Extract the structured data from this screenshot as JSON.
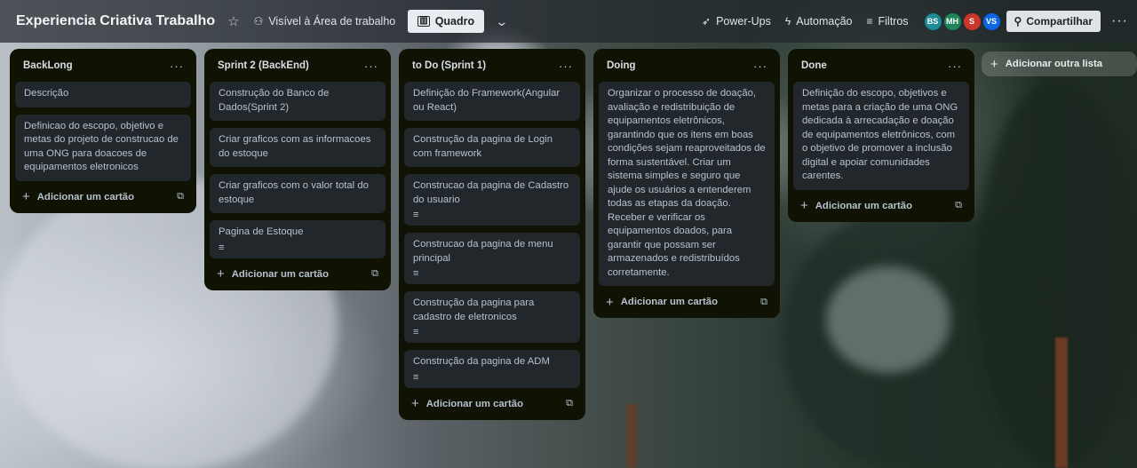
{
  "header": {
    "board_title": "Experiencia Criativa Trabalho",
    "visibility_label": "Visível à Área de trabalho",
    "view_label": "Quadro",
    "powerups_label": "Power-Ups",
    "automation_label": "Automação",
    "filters_label": "Filtros",
    "share_label": "Compartilhar",
    "members": [
      {
        "initials": "BS",
        "color": "#1d8a94"
      },
      {
        "initials": "MH",
        "color": "#1f845a"
      },
      {
        "initials": "S",
        "color": "#c9372c"
      },
      {
        "initials": "VS",
        "color": "#0c66e4"
      }
    ]
  },
  "lists": [
    {
      "title": "BackLong",
      "cards": [
        {
          "text": "Descrição"
        },
        {
          "text": "Definicao do escopo, objetivo e metas do projeto de construcao de uma ONG para doacoes de equipamentos eletronicos"
        }
      ],
      "add_label": "Adicionar um cartão"
    },
    {
      "title": "Sprint 2 (BackEnd)",
      "cards": [
        {
          "text": "Construção do Banco de Dados(Sprint 2)"
        },
        {
          "text": "Criar graficos com as informacoes do estoque"
        },
        {
          "text": "Criar graficos com o valor total do estoque"
        },
        {
          "text": "Pagina de Estoque"
        }
      ],
      "add_label": "Adicionar um cartão"
    },
    {
      "title": "to Do (Sprint 1)",
      "cards": [
        {
          "text": "Definição do Framework(Angular ou React)"
        },
        {
          "text": "Construção da pagina de Login com framework"
        },
        {
          "text": "Construcao da pagina de Cadastro do usuario"
        },
        {
          "text": "Construcao da pagina de menu principal"
        },
        {
          "text": "Construção da pagina para cadastro de eletronicos"
        },
        {
          "text": "Construção da pagina de ADM"
        }
      ],
      "add_label": "Adicionar um cartão"
    },
    {
      "title": "Doing",
      "cards": [
        {
          "text": "Organizar o processo de doação, avaliação e redistribuição de equipamentos eletrônicos, garantindo que os itens em boas condições sejam reaproveitados de forma sustentável. Criar um sistema simples e seguro que ajude os usuários a entenderem todas as etapas da doação. Receber e verificar os equipamentos doados, para garantir que possam ser armazenados e redistribuídos corretamente."
        }
      ],
      "add_label": "Adicionar um cartão"
    },
    {
      "title": "Done",
      "cards": [
        {
          "text": "Definição do escopo, objetivos e metas para a criação de uma ONG dedicada à arrecadação e doação de equipamentos eletrônicos, com o objetivo de promover a inclusão digital e apoiar comunidades carentes."
        }
      ],
      "add_label": "Adicionar um cartão"
    }
  ],
  "add_list_label": "Adicionar outra lista"
}
